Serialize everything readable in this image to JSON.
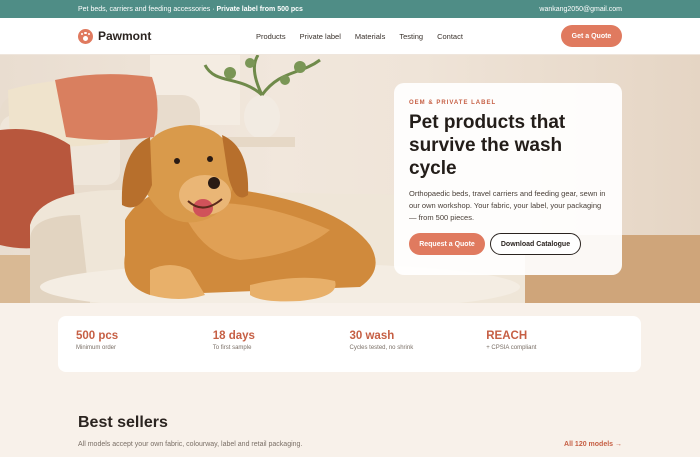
{
  "topbar": {
    "message_prefix": "Pet beds, carriers and feeding accessories · ",
    "message_bold": "Private label from 500 pcs",
    "email": "wankang2050@gmail.com"
  },
  "nav": {
    "brand": "Pawmont",
    "items": [
      "Products",
      "Private label",
      "Materials",
      "Testing",
      "Contact"
    ],
    "cta_label": "Get a Quote"
  },
  "hero": {
    "eyebrow": "OEM & PRIVATE LABEL",
    "headline": "Pet products that survive the wash cycle",
    "lede": "Orthopaedic beds, travel carriers and feeding gear, sewn in our own workshop. Your fabric, your label, your packaging — from 500 pieces.",
    "primary_label": "Request a Quote",
    "secondary_label": "Download Catalogue"
  },
  "stats": [
    {
      "value": "500 pcs",
      "label": "Minimum order"
    },
    {
      "value": "18 days",
      "label": "To first sample"
    },
    {
      "value": "30 wash",
      "label": "Cycles tested, no shrink"
    },
    {
      "value": "REACH",
      "label": "+ CPSIA compliant"
    }
  ],
  "best_sellers": {
    "title": "Best sellers",
    "subtitle": "All models accept your own fabric, colourway, label and retail packaging.",
    "link": "All 120 models →"
  },
  "colors": {
    "accent": "#e07a5f",
    "topbar": "#4f8d86",
    "accent_text": "#c65f44"
  }
}
